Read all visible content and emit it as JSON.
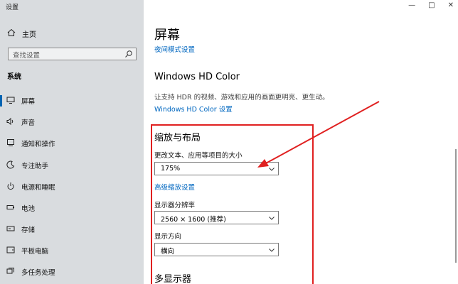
{
  "window": {
    "title": "设置",
    "controls": [
      "—",
      "□",
      "✕"
    ]
  },
  "sidebar": {
    "home_label": "主页",
    "search_placeholder": "查找设置",
    "section_label": "系统",
    "items": [
      {
        "label": "屏幕",
        "icon": "monitor-icon",
        "active": true
      },
      {
        "label": "声音",
        "icon": "speaker-icon"
      },
      {
        "label": "通知和操作",
        "icon": "notification-icon"
      },
      {
        "label": "专注助手",
        "icon": "moon-icon"
      },
      {
        "label": "电源和睡眠",
        "icon": "power-icon"
      },
      {
        "label": "电池",
        "icon": "battery-icon"
      },
      {
        "label": "存储",
        "icon": "storage-icon"
      },
      {
        "label": "平板电脑",
        "icon": "tablet-icon"
      },
      {
        "label": "多任务处理",
        "icon": "multitask-icon"
      }
    ]
  },
  "main": {
    "title": "屏幕",
    "night_mode_link": "夜间模式设置",
    "hd_color": {
      "heading": "Windows HD Color",
      "description": "让支持 HDR 的视频、游戏和应用的画面更明亮、更生动。",
      "link": "Windows HD Color 设置"
    },
    "scale_layout": {
      "heading": "缩放与布局",
      "scale_label": "更改文本、应用等项目的大小",
      "scale_value": "175%",
      "advanced_link": "高级缩放设置",
      "resolution_label": "显示器分辨率",
      "resolution_value": "2560 × 1600 (推荐)",
      "orientation_label": "显示方向",
      "orientation_value": "横向"
    },
    "multi_display_heading": "多显示器"
  },
  "colors": {
    "accent": "#0067c0",
    "annotation": "#e02020",
    "sidebar_bg": "#d9dcdf"
  }
}
